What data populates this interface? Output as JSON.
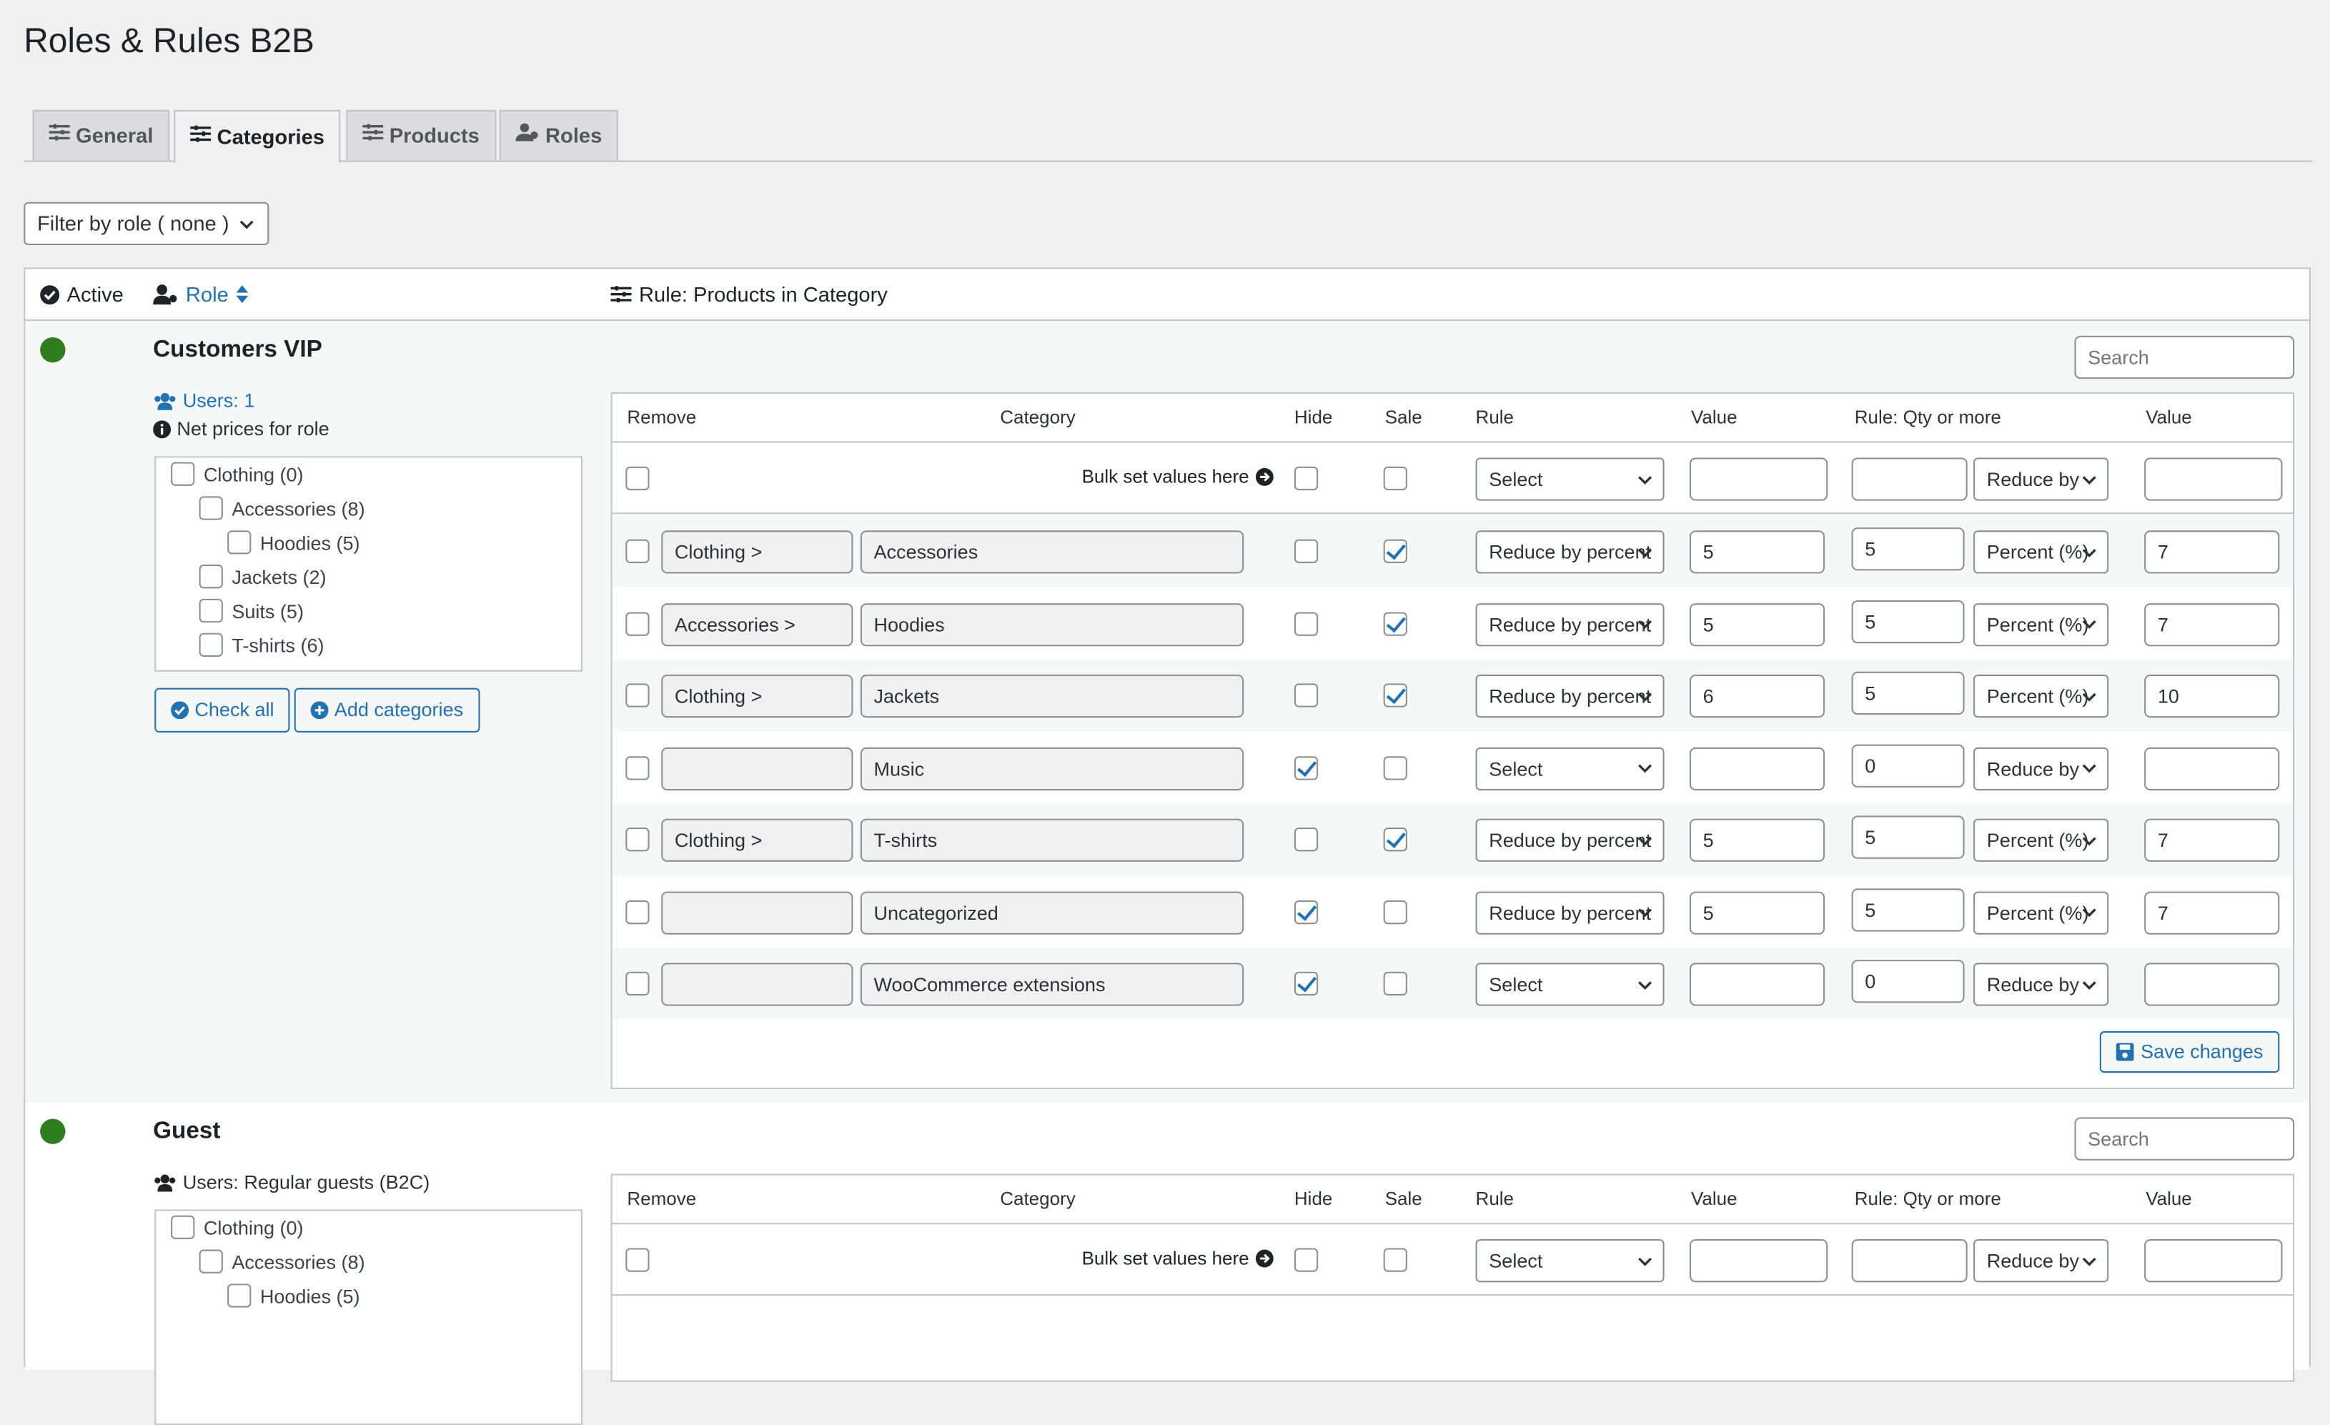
{
  "page": {
    "title": "Roles & Rules B2B"
  },
  "tabs": [
    {
      "label": "General",
      "icon": "sliders-icon"
    },
    {
      "label": "Categories",
      "icon": "sliders-icon",
      "active": true
    },
    {
      "label": "Products",
      "icon": "sliders-icon"
    },
    {
      "label": "Roles",
      "icon": "users-icon"
    }
  ],
  "filter": {
    "label": "Filter by role ( none )"
  },
  "table_header": {
    "active": "Active",
    "role": "Role",
    "rule": "Rule: Products in Category"
  },
  "rules_columns": {
    "remove": "Remove",
    "category": "Category",
    "hide": "Hide",
    "sale": "Sale",
    "rule": "Rule",
    "value": "Value",
    "qty": "Rule: Qty or more",
    "value2": "Value"
  },
  "search_placeholder": "Search",
  "bulk_label": "Bulk set values here",
  "bulk": {
    "rule": "Select",
    "qty_rule": "Reduce by"
  },
  "roles": [
    {
      "name": "Customers VIP",
      "active_color": "#2e7d1f",
      "users": "Users: 1",
      "net_prices": "Net prices for role",
      "tree": [
        "Clothing (0)",
        "Accessories (8)",
        "Hoodies (5)",
        "Jackets (2)",
        "Suits (5)",
        "T-shirts (6)"
      ],
      "check_all": "Check all",
      "add_categories": "Add categories",
      "save": "Save changes",
      "rows": [
        {
          "parent": "Clothing >",
          "category": "Accessories",
          "hide": false,
          "sale": true,
          "rule": "Reduce by percent",
          "value": "5",
          "qty": "5",
          "qty_rule": "Percent (%)",
          "value2": "7"
        },
        {
          "parent": "Accessories >",
          "category": "Hoodies",
          "hide": false,
          "sale": true,
          "rule": "Reduce by percent",
          "value": "5",
          "qty": "5",
          "qty_rule": "Percent (%)",
          "value2": "7"
        },
        {
          "parent": "Clothing >",
          "category": "Jackets",
          "hide": false,
          "sale": true,
          "rule": "Reduce by percent",
          "value": "6",
          "qty": "5",
          "qty_rule": "Percent (%)",
          "value2": "10"
        },
        {
          "parent": "",
          "category": "Music",
          "hide": true,
          "sale": false,
          "rule": "Select",
          "value": "",
          "qty": "0",
          "qty_rule": "Reduce by",
          "value2": ""
        },
        {
          "parent": "Clothing >",
          "category": "T-shirts",
          "hide": false,
          "sale": true,
          "rule": "Reduce by percent",
          "value": "5",
          "qty": "5",
          "qty_rule": "Percent (%)",
          "value2": "7"
        },
        {
          "parent": "",
          "category": "Uncategorized",
          "hide": true,
          "sale": false,
          "rule": "Reduce by percent",
          "value": "5",
          "qty": "5",
          "qty_rule": "Percent (%)",
          "value2": "7"
        },
        {
          "parent": "",
          "category": "WooCommerce extensions",
          "hide": true,
          "sale": false,
          "rule": "Select",
          "value": "",
          "qty": "0",
          "qty_rule": "Reduce by",
          "value2": ""
        }
      ]
    },
    {
      "name": "Guest",
      "active_color": "#2e7d1f",
      "users": "Users: Regular guests (B2C)",
      "tree": [
        "Clothing (0)",
        "Accessories (8)",
        "Hoodies (5)"
      ]
    }
  ]
}
